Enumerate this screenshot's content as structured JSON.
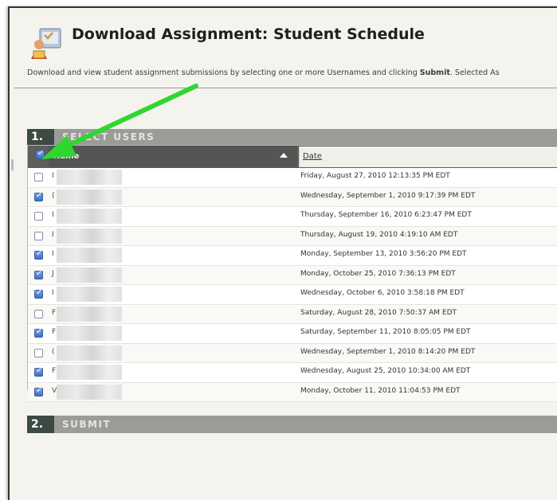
{
  "page": {
    "title": "Download Assignment: Student Schedule",
    "description_pre": "Download and view student assignment submissions by selecting one or more Usernames and clicking ",
    "description_strong": "Submit",
    "description_post": ". Selected As"
  },
  "section1": {
    "number": "1.",
    "label": "SELECT USERS"
  },
  "section2": {
    "number": "2.",
    "label": "SUBMIT"
  },
  "table": {
    "col_name": "Name",
    "col_date": "Date",
    "header_checked": true,
    "rows": [
      {
        "checked": false,
        "name": "I",
        "date": "Friday, August 27, 2010 12:13:35 PM EDT"
      },
      {
        "checked": true,
        "name": "(",
        "date": "Wednesday, September 1, 2010 9:17:39 PM EDT"
      },
      {
        "checked": false,
        "name": "I",
        "date": "Thursday, September 16, 2010 6:23:47 PM EDT"
      },
      {
        "checked": false,
        "name": "I",
        "date": "Thursday, August 19, 2010 4:19:10 AM EDT"
      },
      {
        "checked": true,
        "name": "I",
        "date": "Monday, September 13, 2010 3:56:20 PM EDT"
      },
      {
        "checked": true,
        "name": "J",
        "date": "Monday, October 25, 2010 7:36:13 PM EDT"
      },
      {
        "checked": true,
        "name": "I",
        "date": "Wednesday, October 6, 2010 3:58:18 PM EDT"
      },
      {
        "checked": false,
        "name": "F",
        "date": "Saturday, August 28, 2010 7:50:37 AM EDT"
      },
      {
        "checked": true,
        "name": "F",
        "date": "Saturday, September 11, 2010 8:05:05 PM EDT"
      },
      {
        "checked": false,
        "name": "(",
        "date": "Wednesday, September 1, 2010 8:14:20 PM EDT"
      },
      {
        "checked": true,
        "name": "F",
        "date": "Wednesday, August 25, 2010 10:34:00 AM EDT"
      },
      {
        "checked": true,
        "name": "V",
        "date": "Monday, October 11, 2010 11:04:53 PM EDT"
      }
    ]
  },
  "annotation": {
    "arrow_color": "#2fd62f"
  },
  "icons": {
    "page_icon": "schedule-person-icon"
  }
}
